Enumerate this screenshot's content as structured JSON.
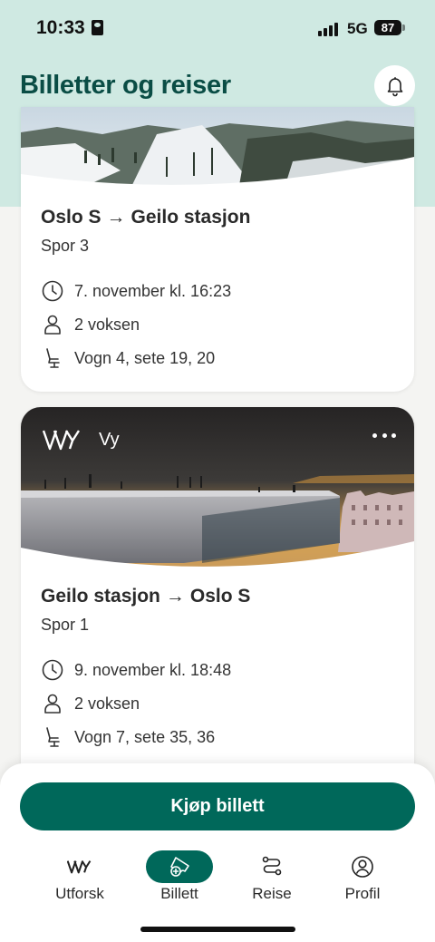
{
  "status_bar": {
    "time": "10:33",
    "network": "5G",
    "battery": "87"
  },
  "header": {
    "title": "Billetter og reiser"
  },
  "tickets": [
    {
      "from": "Oslo S",
      "arrow": "→",
      "to": "Geilo stasjon",
      "track": "Spor 3",
      "datetime": "7. november kl. 16:23",
      "passengers": "2 voksen",
      "seats": "Vogn 4, sete 19, 20"
    },
    {
      "operator": "Vy",
      "from": "Geilo stasjon",
      "arrow": "→",
      "to": "Oslo S",
      "track": "Spor 1",
      "datetime": "9. november kl. 18:48",
      "passengers": "2 voksen",
      "seats": "Vogn 7, sete 35, 36"
    }
  ],
  "actions": {
    "buy_ticket": "Kjøp billett"
  },
  "tabbar": {
    "items": [
      {
        "label": "Utforsk",
        "icon": "vy-logo-icon",
        "active": false
      },
      {
        "label": "Billett",
        "icon": "ticket-add-icon",
        "active": true
      },
      {
        "label": "Reise",
        "icon": "route-icon",
        "active": false
      },
      {
        "label": "Profil",
        "icon": "profile-icon",
        "active": false
      }
    ]
  },
  "colors": {
    "brand": "#00685a",
    "header_bg": "#cfe9e2",
    "title": "#0a4d45"
  }
}
